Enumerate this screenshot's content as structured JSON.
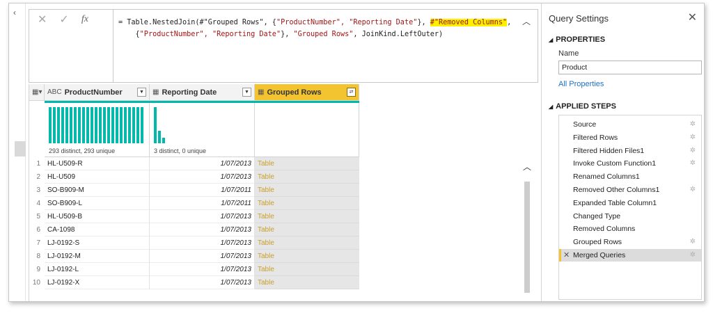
{
  "formula": {
    "cancel_icon": "✕",
    "commit_icon": "✓",
    "fx_label": "fx",
    "line1_a": "= Table.NestedJoin(#\"Grouped Rows\", {",
    "line1_b": "\"ProductNumber\", \"Reporting Date\"",
    "line1_c": "}, ",
    "line1_d": "#\"Removed Columns\"",
    "line1_e": ",",
    "line2_a": "    {",
    "line2_b": "\"ProductNumber\", \"Reporting Date\"",
    "line2_c": "}, ",
    "line2_d": "\"Grouped Rows\"",
    "line2_e": ", JoinKind.LeftOuter)"
  },
  "columns": [
    {
      "type_icon": "ABC",
      "name": "ProductNumber"
    },
    {
      "type_icon": "▦",
      "name": "Reporting Date"
    },
    {
      "type_icon": "▦",
      "name": "Grouped Rows",
      "expand_icon": "⇄"
    }
  ],
  "profile": {
    "col1_stat": "293 distinct, 293 unique",
    "col2_stat": "3 distinct, 0 unique"
  },
  "rows": [
    {
      "n": "1",
      "product": "HL-U509-R",
      "date": "1/07/2013",
      "grouped": "Table"
    },
    {
      "n": "2",
      "product": "HL-U509",
      "date": "1/07/2013",
      "grouped": "Table"
    },
    {
      "n": "3",
      "product": "SO-B909-M",
      "date": "1/07/2011",
      "grouped": "Table"
    },
    {
      "n": "4",
      "product": "SO-B909-L",
      "date": "1/07/2011",
      "grouped": "Table"
    },
    {
      "n": "5",
      "product": "HL-U509-B",
      "date": "1/07/2013",
      "grouped": "Table"
    },
    {
      "n": "6",
      "product": "CA-1098",
      "date": "1/07/2013",
      "grouped": "Table"
    },
    {
      "n": "7",
      "product": "LJ-0192-S",
      "date": "1/07/2013",
      "grouped": "Table"
    },
    {
      "n": "8",
      "product": "LJ-0192-M",
      "date": "1/07/2013",
      "grouped": "Table"
    },
    {
      "n": "9",
      "product": "LJ-0192-L",
      "date": "1/07/2013",
      "grouped": "Table"
    },
    {
      "n": "10",
      "product": "LJ-0192-X",
      "date": "1/07/2013",
      "grouped": "Table"
    }
  ],
  "query_settings": {
    "title": "Query Settings",
    "properties_heading": "PROPERTIES",
    "name_label": "Name",
    "name_value": "Product",
    "all_properties": "All Properties",
    "applied_steps_heading": "APPLIED STEPS",
    "steps": [
      {
        "label": "Source",
        "gear": true
      },
      {
        "label": "Filtered Rows",
        "gear": true
      },
      {
        "label": "Filtered Hidden Files1",
        "gear": true
      },
      {
        "label": "Invoke Custom Function1",
        "gear": true
      },
      {
        "label": "Renamed Columns1",
        "gear": false
      },
      {
        "label": "Removed Other Columns1",
        "gear": true
      },
      {
        "label": "Expanded Table Column1",
        "gear": false
      },
      {
        "label": "Changed Type",
        "gear": false
      },
      {
        "label": "Removed Columns",
        "gear": false
      },
      {
        "label": "Grouped Rows",
        "gear": true
      },
      {
        "label": "Merged Queries",
        "gear": true,
        "selected": true
      }
    ]
  },
  "colors": {
    "accent": "#01b8aa",
    "selected_col": "#f4c430",
    "link": "#1f6fc5",
    "table_text": "#c8a02a",
    "highlight": "#fff000"
  }
}
